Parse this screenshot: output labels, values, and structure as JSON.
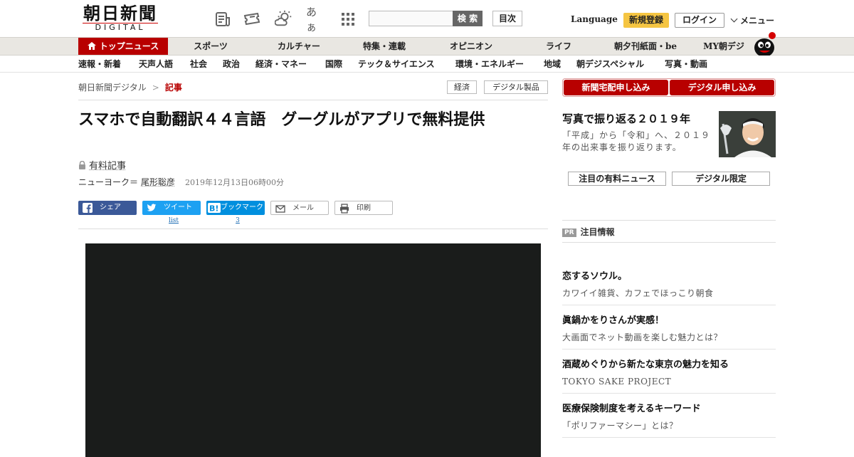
{
  "header": {
    "logo_jp": "朝日新聞",
    "logo_en": "DIGITAL",
    "icons": [
      "newspaper-icon",
      "ticket-icon",
      "weather-icon",
      "font-size-icon",
      "grid-menu-icon"
    ],
    "font_size_label": "あぁ",
    "search_placeholder": "",
    "search_button": "検 索",
    "toc_button": "目次",
    "language": "Language",
    "signup": "新規登録",
    "login": "ログイン",
    "menu": "メニュー"
  },
  "nav_main": [
    "トップニュース",
    "スポーツ",
    "カルチャー",
    "特集・連載",
    "オピニオン",
    "ライフ",
    "朝夕刊紙面・be",
    "MY朝デジ"
  ],
  "nav_sub": [
    "速報・新着",
    "天声人語",
    "社会",
    "政治",
    "経済・マネー",
    "国際",
    "テック＆サイエンス",
    "環境・エネルギー",
    "地域",
    "朝デジスペシャル",
    "写真・動画"
  ],
  "breadcrumb": {
    "home": "朝日新聞デジタル",
    "separator": ">",
    "current": "記事",
    "tags": [
      "経済",
      "デジタル製品"
    ]
  },
  "article": {
    "title": "スマホで自動翻訳４４言語　グーグルがアプリで無料提供",
    "paid_label": "有料記事",
    "location": "ニューヨーク＝",
    "author": "尾形聡彦",
    "date": "2019年12月13日06時00分"
  },
  "share": {
    "facebook": "シェア",
    "twitter": "ツイート",
    "hatena": "ブックマーク",
    "mail": "メール",
    "print": "印刷",
    "twitter_count": "list",
    "hatena_count": "3"
  },
  "sidebar": {
    "sub_home": "新聞宅配申し込み",
    "sub_digital": "デジタル申し込み",
    "feature_title": "写真で振り返る２０１９年",
    "feature_desc": "「平成」から「令和」へ、２０１９年の出来事を振り返ります。",
    "btn_paid_news": "注目の有料ニュース",
    "btn_digital_only": "デジタル限定",
    "pr_badge": "PR",
    "pr_heading": "注目情報",
    "pr_items": [
      {
        "title": "恋するソウル。",
        "desc": "カワイイ雑貨、カフェでほっこり朝食"
      },
      {
        "title": "眞鍋かをりさんが実感！",
        "desc": "大画面でネット動画を楽しむ魅力とは？"
      },
      {
        "title": "酒蔵めぐりから新たな東京の魅力を知る",
        "desc": "TOKYO SAKE PROJECT"
      },
      {
        "title": "医療保険制度を考えるキーワード",
        "desc": "「ポリファーマシー」とは？"
      }
    ]
  },
  "colors": {
    "brand_red": "#b80000",
    "signup_yellow": "#f5c542",
    "facebook_blue": "#3b5998",
    "twitter_blue": "#1da1f2",
    "hatena_blue": "#008fde"
  }
}
